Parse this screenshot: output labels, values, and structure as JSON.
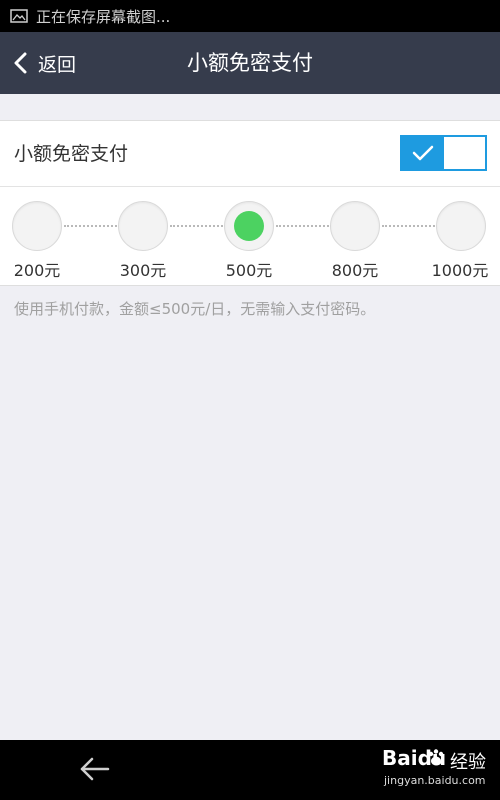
{
  "status_bar": {
    "icon": "screenshot-image-icon",
    "text": "正在保存屏幕截图..."
  },
  "nav": {
    "back_label": "返回",
    "title": "小额免密支付",
    "back_icon": "chevron-left-icon"
  },
  "toggle_row": {
    "label": "小额免密支付",
    "enabled": true,
    "accent_color": "#1e9be0"
  },
  "amount_selector": {
    "options": [
      "200元",
      "300元",
      "500元",
      "800元",
      "1000元"
    ],
    "selected_index": 2,
    "selected_color": "#4cd261"
  },
  "description": "使用手机付款，金额≤500元/日，无需输入支付密码。",
  "system_bar": {
    "back_icon": "arrow-left-icon"
  },
  "watermark": {
    "logo_text": "Bai",
    "logo_text_2": "du",
    "cn_text": "经验",
    "url": "jingyan.baidu.com"
  },
  "colors": {
    "nav_background": "#363c4c",
    "page_background": "#efeff4"
  }
}
